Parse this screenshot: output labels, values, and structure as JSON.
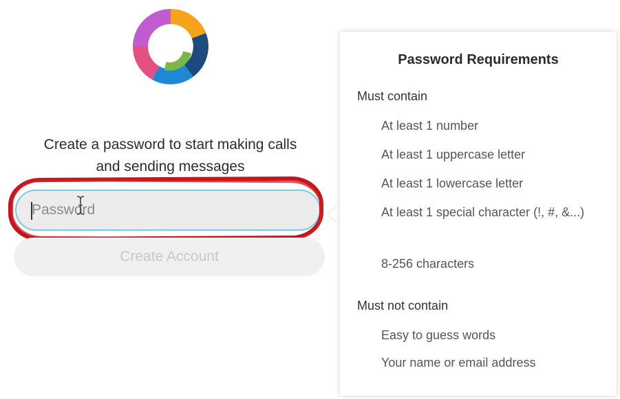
{
  "logo": {
    "icon": "webex-logo-icon",
    "colors": [
      "#e4507f",
      "#f5a31a",
      "#7ab74a",
      "#1f88d6",
      "#1e4b7d"
    ]
  },
  "signup": {
    "prompt_line1": "Create a password to start making calls",
    "prompt_line2": "and sending messages",
    "password_placeholder": "Password",
    "create_account_label": "Create Account"
  },
  "requirements": {
    "title": "Password Requirements",
    "must_contain_heading": "Must contain",
    "must_contain": [
      "At least 1 number",
      "At least 1 uppercase letter",
      "At least 1 lowercase letter",
      "At least 1 special character (!, #, &...)",
      "8-256 characters"
    ],
    "must_not_contain_heading": "Must not contain",
    "must_not_contain": [
      "Easy to guess words",
      "Your name or email address"
    ]
  },
  "colors": {
    "annotation_red": "#c4161c",
    "input_focus_border": "#7cc9e6"
  }
}
